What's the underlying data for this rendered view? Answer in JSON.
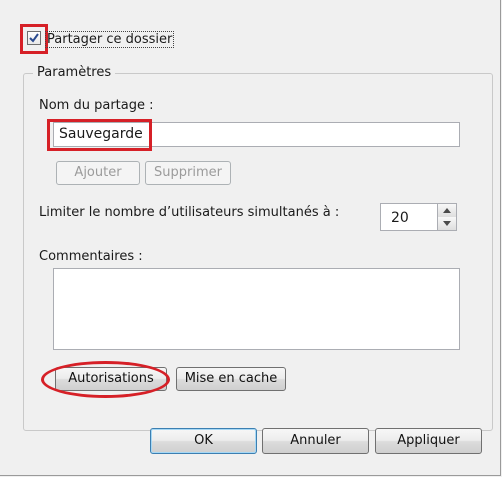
{
  "share_checkbox": {
    "label": "Partager ce dossier",
    "checked": true
  },
  "group": {
    "title": "Paramètres"
  },
  "share_name": {
    "label": "Nom du partage :",
    "value": "Sauvegarde"
  },
  "buttons": {
    "add": "Ajouter",
    "remove": "Supprimer",
    "permissions": "Autorisations",
    "caching": "Mise en cache",
    "ok": "OK",
    "cancel": "Annuler",
    "apply": "Appliquer"
  },
  "user_limit": {
    "label": "Limiter le nombre d’utilisateurs simultanés à :",
    "value": "20"
  },
  "comments": {
    "label": "Commentaires :",
    "value": ""
  },
  "colors": {
    "highlight": "#d62027",
    "dialog_bg": "#f0f0f0"
  },
  "icons": [
    "checkmark-icon",
    "spin-up-arrow-icon",
    "spin-down-arrow-icon"
  ]
}
